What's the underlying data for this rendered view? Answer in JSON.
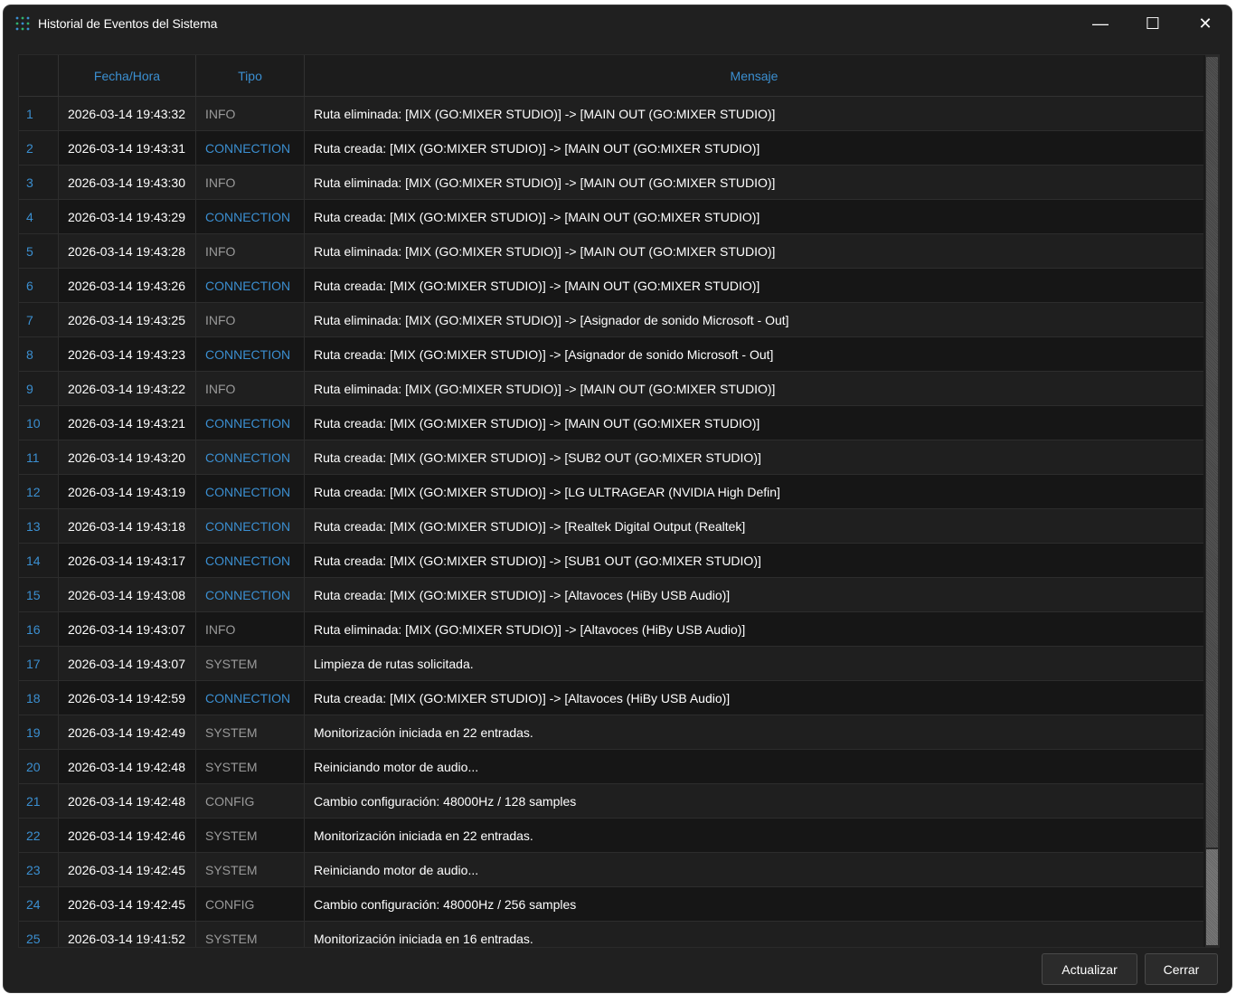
{
  "window": {
    "title": "Historial de Eventos del Sistema",
    "controls": {
      "minimize": "—",
      "maximize": "☐",
      "close": "✕"
    }
  },
  "table": {
    "columns": [
      "Fecha/Hora",
      "Tipo",
      "Mensaje"
    ],
    "rows": [
      {
        "n": "1",
        "date": "2026-03-14 19:43:32",
        "type": "INFO",
        "msg": "Ruta eliminada: [MIX (GO:MIXER STUDIO)] -> [MAIN OUT (GO:MIXER STUDIO)]"
      },
      {
        "n": "2",
        "date": "2026-03-14 19:43:31",
        "type": "CONNECTION",
        "msg": "Ruta creada: [MIX (GO:MIXER STUDIO)] -> [MAIN OUT (GO:MIXER STUDIO)]"
      },
      {
        "n": "3",
        "date": "2026-03-14 19:43:30",
        "type": "INFO",
        "msg": "Ruta eliminada: [MIX (GO:MIXER STUDIO)] -> [MAIN OUT (GO:MIXER STUDIO)]"
      },
      {
        "n": "4",
        "date": "2026-03-14 19:43:29",
        "type": "CONNECTION",
        "msg": "Ruta creada: [MIX (GO:MIXER STUDIO)] -> [MAIN OUT (GO:MIXER STUDIO)]"
      },
      {
        "n": "5",
        "date": "2026-03-14 19:43:28",
        "type": "INFO",
        "msg": "Ruta eliminada: [MIX (GO:MIXER STUDIO)] -> [MAIN OUT (GO:MIXER STUDIO)]"
      },
      {
        "n": "6",
        "date": "2026-03-14 19:43:26",
        "type": "CONNECTION",
        "msg": "Ruta creada: [MIX (GO:MIXER STUDIO)] -> [MAIN OUT (GO:MIXER STUDIO)]"
      },
      {
        "n": "7",
        "date": "2026-03-14 19:43:25",
        "type": "INFO",
        "msg": "Ruta eliminada: [MIX (GO:MIXER STUDIO)] -> [Asignador de sonido Microsoft - Out]"
      },
      {
        "n": "8",
        "date": "2026-03-14 19:43:23",
        "type": "CONNECTION",
        "msg": "Ruta creada: [MIX (GO:MIXER STUDIO)] -> [Asignador de sonido Microsoft - Out]"
      },
      {
        "n": "9",
        "date": "2026-03-14 19:43:22",
        "type": "INFO",
        "msg": "Ruta eliminada: [MIX (GO:MIXER STUDIO)] -> [MAIN OUT (GO:MIXER STUDIO)]"
      },
      {
        "n": "10",
        "date": "2026-03-14 19:43:21",
        "type": "CONNECTION",
        "msg": "Ruta creada: [MIX (GO:MIXER STUDIO)] -> [MAIN OUT (GO:MIXER STUDIO)]"
      },
      {
        "n": "11",
        "date": "2026-03-14 19:43:20",
        "type": "CONNECTION",
        "msg": "Ruta creada: [MIX (GO:MIXER STUDIO)] -> [SUB2 OUT (GO:MIXER STUDIO)]"
      },
      {
        "n": "12",
        "date": "2026-03-14 19:43:19",
        "type": "CONNECTION",
        "msg": "Ruta creada: [MIX (GO:MIXER STUDIO)] -> [LG ULTRAGEAR (NVIDIA High Defin]"
      },
      {
        "n": "13",
        "date": "2026-03-14 19:43:18",
        "type": "CONNECTION",
        "msg": "Ruta creada: [MIX (GO:MIXER STUDIO)] -> [Realtek Digital Output (Realtek]"
      },
      {
        "n": "14",
        "date": "2026-03-14 19:43:17",
        "type": "CONNECTION",
        "msg": "Ruta creada: [MIX (GO:MIXER STUDIO)] -> [SUB1 OUT (GO:MIXER STUDIO)]"
      },
      {
        "n": "15",
        "date": "2026-03-14 19:43:08",
        "type": "CONNECTION",
        "msg": "Ruta creada: [MIX (GO:MIXER STUDIO)] -> [Altavoces (HiBy USB Audio)]"
      },
      {
        "n": "16",
        "date": "2026-03-14 19:43:07",
        "type": "INFO",
        "msg": "Ruta eliminada: [MIX (GO:MIXER STUDIO)] -> [Altavoces (HiBy USB Audio)]"
      },
      {
        "n": "17",
        "date": "2026-03-14 19:43:07",
        "type": "SYSTEM",
        "msg": "Limpieza de rutas solicitada."
      },
      {
        "n": "18",
        "date": "2026-03-14 19:42:59",
        "type": "CONNECTION",
        "msg": "Ruta creada: [MIX (GO:MIXER STUDIO)] -> [Altavoces (HiBy USB Audio)]"
      },
      {
        "n": "19",
        "date": "2026-03-14 19:42:49",
        "type": "SYSTEM",
        "msg": "Monitorización iniciada en 22 entradas."
      },
      {
        "n": "20",
        "date": "2026-03-14 19:42:48",
        "type": "SYSTEM",
        "msg": "Reiniciando motor de audio..."
      },
      {
        "n": "21",
        "date": "2026-03-14 19:42:48",
        "type": "CONFIG",
        "msg": "Cambio configuración: 48000Hz / 128 samples"
      },
      {
        "n": "22",
        "date": "2026-03-14 19:42:46",
        "type": "SYSTEM",
        "msg": "Monitorización iniciada en 22 entradas."
      },
      {
        "n": "23",
        "date": "2026-03-14 19:42:45",
        "type": "SYSTEM",
        "msg": "Reiniciando motor de audio..."
      },
      {
        "n": "24",
        "date": "2026-03-14 19:42:45",
        "type": "CONFIG",
        "msg": "Cambio configuración: 48000Hz / 256 samples"
      },
      {
        "n": "25",
        "date": "2026-03-14 19:41:52",
        "type": "SYSTEM",
        "msg": "Monitorización iniciada en 16 entradas."
      }
    ]
  },
  "buttons": {
    "refresh": "Actualizar",
    "close": "Cerrar"
  },
  "colors": {
    "accent": "#3b8fd1",
    "background": "#202020",
    "grid": "#191919",
    "muted_text": "#9a9a9a"
  }
}
